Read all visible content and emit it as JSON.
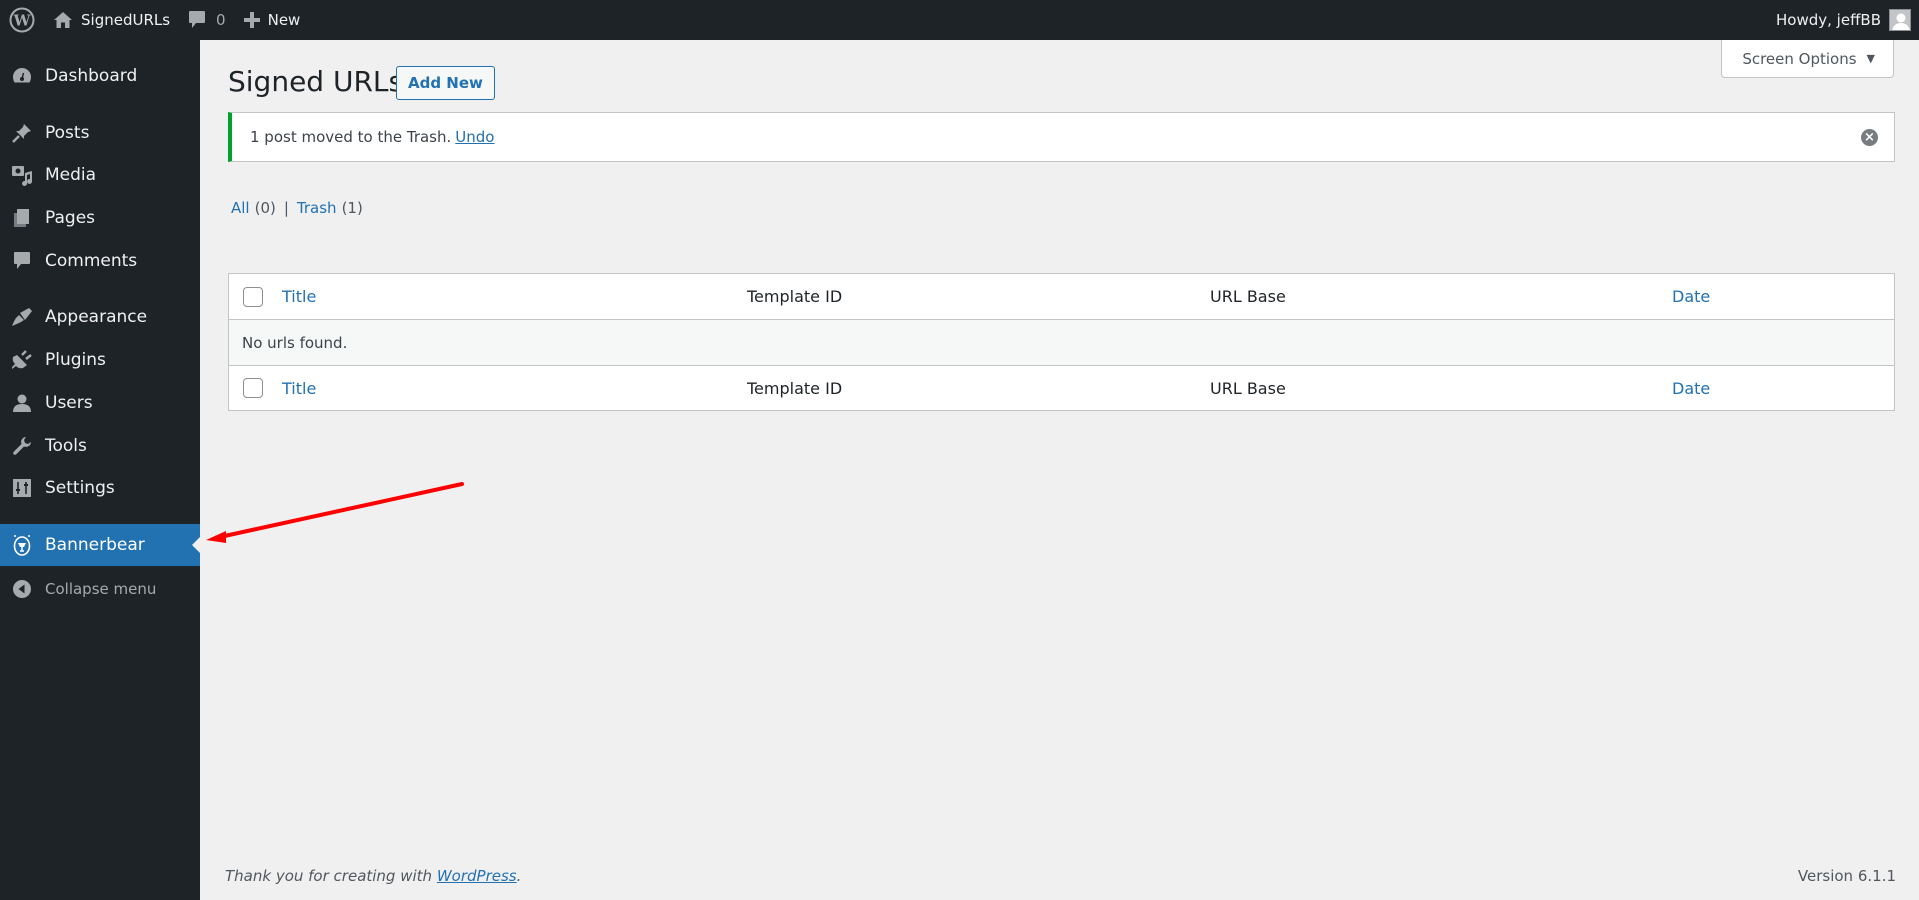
{
  "admin_bar": {
    "wp_logo_icon": "wordpress-logo-icon",
    "site_name": "SignedURLs",
    "comments_count": "0",
    "new_label": "New",
    "greeting": "Howdy, jeffBB"
  },
  "sidebar": {
    "items": [
      {
        "label": "Dashboard",
        "icon": "dashboard-icon"
      },
      {
        "label": "Posts",
        "icon": "pushpin-icon"
      },
      {
        "label": "Media",
        "icon": "media-icon"
      },
      {
        "label": "Pages",
        "icon": "pages-icon"
      },
      {
        "label": "Comments",
        "icon": "comment-icon"
      },
      {
        "label": "Appearance",
        "icon": "paintbrush-icon"
      },
      {
        "label": "Plugins",
        "icon": "plugin-icon"
      },
      {
        "label": "Users",
        "icon": "user-icon"
      },
      {
        "label": "Tools",
        "icon": "wrench-icon"
      },
      {
        "label": "Settings",
        "icon": "settings-icon"
      },
      {
        "label": "Bannerbear",
        "icon": "bannerbear-icon",
        "active": true
      }
    ],
    "collapse_label": "Collapse menu"
  },
  "screen_options": {
    "label": "Screen Options",
    "arrow": "▼"
  },
  "page": {
    "title": "Signed URLs",
    "add_new_label": "Add New"
  },
  "notice": {
    "message": "1 post moved to the Trash.",
    "undo_label": "Undo",
    "dismiss": "×"
  },
  "views": {
    "all_label": "All",
    "all_count": "(0)",
    "separator": "|",
    "trash_label": "Trash",
    "trash_count": "(1)"
  },
  "table": {
    "columns": [
      "Title",
      "Template ID",
      "URL Base",
      "Date"
    ],
    "empty_message": "No urls found."
  },
  "footer": {
    "thanks_prefix": "Thank you for creating with",
    "wordpress_link": "WordPress",
    "thanks_suffix": ".",
    "version": "Version 6.1.1"
  },
  "colors": {
    "admin_dark": "#1d2327",
    "accent": "#2271b1",
    "success": "#00a32a",
    "annotation": "#ff0000"
  }
}
